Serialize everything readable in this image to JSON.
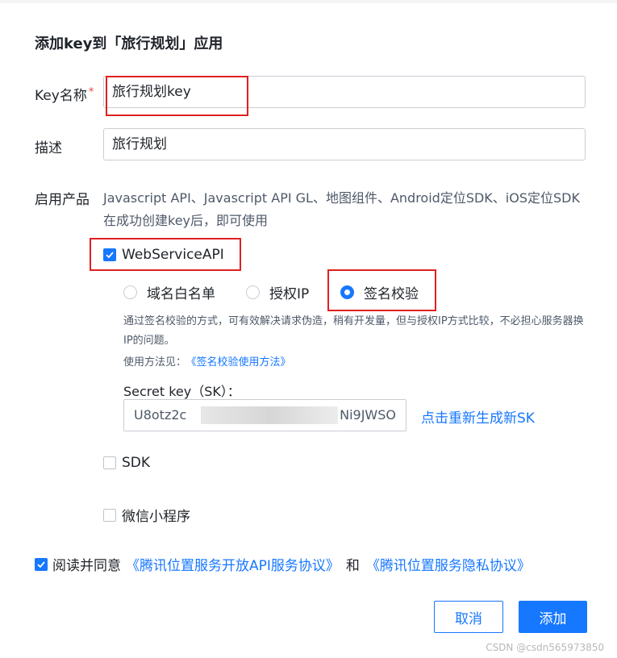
{
  "dialog": {
    "title": "添加key到「旅行规划」应用"
  },
  "form": {
    "key_name": {
      "label": "Key名称",
      "required_mark": "*",
      "value": "旅行规划key"
    },
    "description": {
      "label": "描述",
      "value": "旅行规划"
    },
    "products": {
      "label": "启用产品",
      "text": "Javascript API、Javascript API GL、地图组件、Android定位SDK、iOS定位SDK在成功创建key后，即可使用"
    },
    "webservice": {
      "label": "WebServiceAPI",
      "checked": true,
      "options": [
        {
          "label": "域名白名单",
          "selected": false
        },
        {
          "label": "授权IP",
          "selected": false
        },
        {
          "label": "签名校验",
          "selected": true
        }
      ],
      "description": "通过签名校验的方式，可有效解决请求伪造，稍有开发量，但与授权IP方式比较，不必担心服务器换IP的问题。",
      "usage_prefix": "使用方法见：",
      "usage_link": "《签名校验使用方法》",
      "secret_label": "Secret key（SK）：",
      "secret_value_start": "U8otz2c",
      "secret_value_end": "Ni9JWSO",
      "regenerate_link": "点击重新生成新SK"
    },
    "sdk": {
      "label": "SDK",
      "checked": false
    },
    "miniprogram": {
      "label": "微信小程序",
      "checked": false
    }
  },
  "agreement": {
    "checked": true,
    "prefix": "阅读并同意",
    "link1": "《腾讯位置服务开放API服务协议》",
    "middle": "和",
    "link2": "《腾讯位置服务隐私协议》"
  },
  "buttons": {
    "cancel": "取消",
    "add": "添加"
  },
  "watermark": "CSDN @csdn565973850",
  "colors": {
    "accent": "#1677ff",
    "highlight": "#e02020"
  }
}
